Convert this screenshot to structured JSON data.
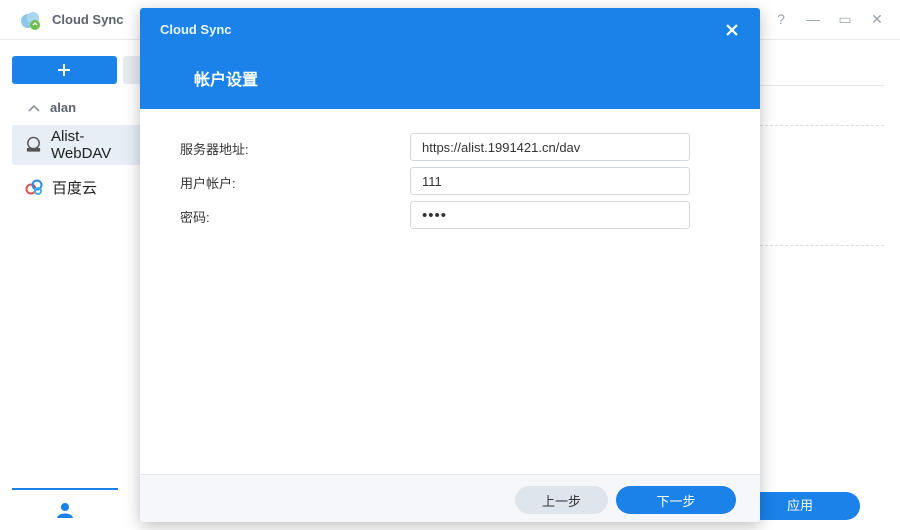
{
  "app": {
    "title": "Cloud Sync",
    "window_controls": [
      "?",
      "—",
      "▭",
      "✕"
    ],
    "add_label": "+",
    "group": "alan",
    "items": [
      {
        "label": "Alist-WebDAV",
        "icon": "webdav-icon"
      },
      {
        "label": "百度云",
        "icon": "baidu-cloud-icon"
      }
    ],
    "apply_label": "应用"
  },
  "dialog": {
    "app_title": "Cloud Sync",
    "heading": "帐户设置",
    "fields": {
      "server": {
        "label": "服务器地址:",
        "value": "https://alist.1991421.cn/dav"
      },
      "user": {
        "label": "用户帐户:",
        "value": "111"
      },
      "password": {
        "label": "密码:",
        "value": "••••"
      }
    },
    "prev_label": "上一步",
    "next_label": "下一步"
  },
  "colors": {
    "accent": "#1a82e8",
    "sidebar_active": "#e7eef6"
  }
}
